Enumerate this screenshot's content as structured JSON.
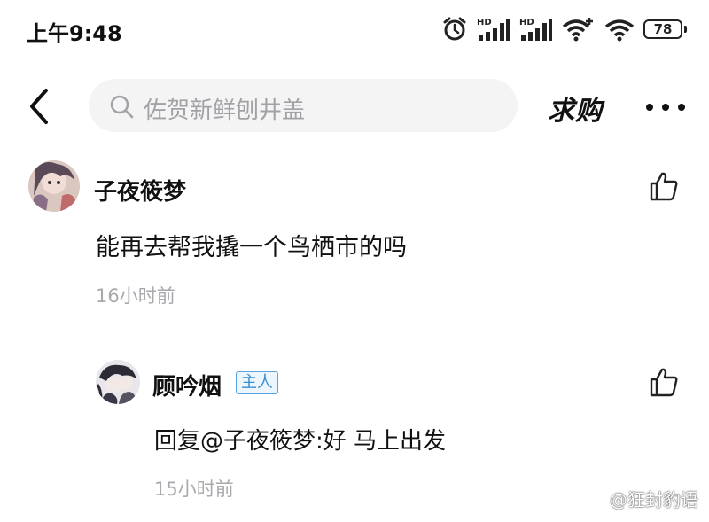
{
  "status_bar": {
    "time": "上午9:48",
    "battery": "78",
    "icons": [
      "alarm-icon",
      "signal-hd-icon",
      "signal-hd-icon",
      "wifi-plus-icon",
      "wifi-icon",
      "battery-icon"
    ]
  },
  "top_bar": {
    "search_placeholder": "佐贺新鲜刨井盖",
    "title": "求购"
  },
  "comments": [
    {
      "username": "子夜筱梦",
      "content": "能再去帮我撬一个鸟栖市的吗",
      "time": "16小时前"
    }
  ],
  "reply": {
    "username": "顾吟烟",
    "badge": "主人",
    "content": "回复@子夜筱梦:好 马上出发",
    "time": "15小时前"
  },
  "watermark": "@狂封豹语",
  "colors": {
    "search_bg": "#f4f4f5",
    "muted_text": "#a8a8ad",
    "badge_blue": "#3a8fd0"
  }
}
